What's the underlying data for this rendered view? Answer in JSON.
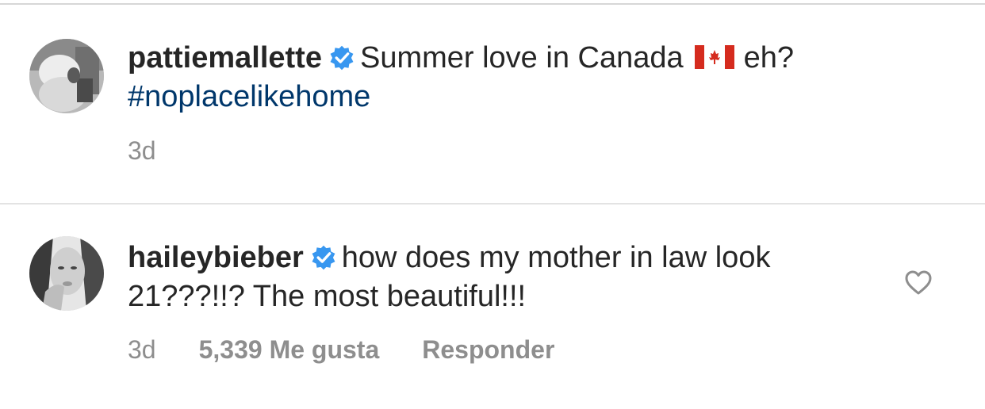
{
  "comments": [
    {
      "username": "pattiemallette",
      "verified": true,
      "text_before_flag": "Summer love in Canada",
      "flag": "canada-flag",
      "text_after_flag": "eh?",
      "hashtag": "#noplacelikehome",
      "time": "3d"
    },
    {
      "username": "haileybieber",
      "verified": true,
      "text": "how does my mother in law look 21???!!? The most beautiful!!!",
      "time": "3d",
      "likes": "5,339 Me gusta",
      "reply": "Responder",
      "like_icon": "heart-outline-icon"
    }
  ],
  "colors": {
    "text": "#262626",
    "muted": "#8e8e8e",
    "hashtag": "#00376b",
    "verified_badge": "#3897f0",
    "flag_red": "#d52b1e"
  }
}
